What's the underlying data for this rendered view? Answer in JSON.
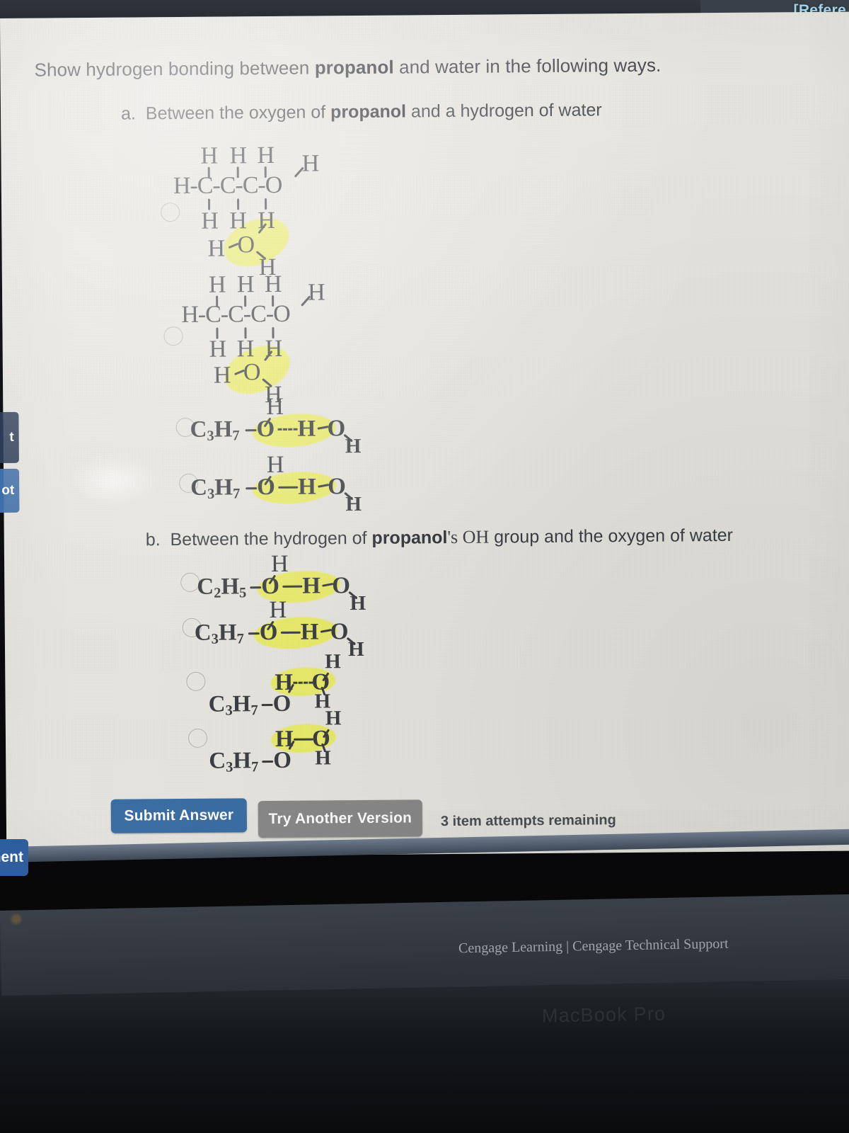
{
  "browser": {
    "tab_label": "[Refere"
  },
  "sidebar": {
    "buttons": [
      {
        "label": "t"
      },
      {
        "label": "ot"
      },
      {
        "label": "ment"
      }
    ]
  },
  "question": {
    "stem_pre": "Show hydrogen bonding between ",
    "stem_bold": "propanol",
    "stem_post": " and water in the following ways.",
    "part_a": {
      "marker": "a.",
      "text_pre": "Between the oxygen of ",
      "text_bold": "propanol",
      "text_post": " and a hydrogen of water"
    },
    "part_b": {
      "marker": "b.",
      "text_pre": "Between the hydrogen of ",
      "text_bold": "propanol",
      "text_post_serif": "'s OH",
      "text_post": " group and the oxygen of water"
    }
  },
  "answers": {
    "a": [
      {
        "id": "a1",
        "type": "expanded-structure",
        "atoms": [
          "H",
          "C",
          "C",
          "C",
          "O",
          "H",
          "H",
          "H",
          "H",
          "H",
          "H",
          "H",
          "H",
          "O",
          "H"
        ],
        "description": "H-C-C-C-O with H above each C and H below each C, terminal H on O, plus water H-O-H highlighted",
        "backbone": "H-C-C-C-O",
        "top_hydrogens": [
          "H",
          "H",
          "H"
        ],
        "terminal_h": "H",
        "bottom_hydrogens": [
          "H",
          "H",
          "H"
        ],
        "water": {
          "left_h": "H",
          "oxygen": "O",
          "lower_h": "H"
        },
        "highlighted": true
      },
      {
        "id": "a2",
        "type": "expanded-structure",
        "backbone": "H-C-C-C-O",
        "top_hydrogens": [
          "H",
          "H",
          "H"
        ],
        "terminal_h": "H",
        "bottom_hydrogens": [
          "H",
          "H",
          "H"
        ],
        "water": {
          "left_h": "H",
          "oxygen": "O",
          "lower_h": "H"
        },
        "highlighted": true
      },
      {
        "id": "a3",
        "type": "condensed",
        "group": "C3H7",
        "oxygen": "O",
        "bond_style": "dashed",
        "bridge_h": "H",
        "water_o": "O",
        "water_top_h": "H",
        "water_lower_h": "H",
        "highlighted": true
      },
      {
        "id": "a4",
        "type": "condensed",
        "group": "C3H7",
        "oxygen": "O",
        "bond_style": "solid",
        "bridge_h": "H",
        "water_o": "O",
        "water_top_h": "H",
        "water_lower_h": "H",
        "highlighted": true
      }
    ],
    "b": [
      {
        "id": "b1",
        "type": "condensed",
        "group": "C2H5",
        "oxygen": "O",
        "bond_style": "solid",
        "bridge_h": "H",
        "water_o": "O",
        "water_top_h": "H",
        "water_lower_h": "H",
        "highlighted": true
      },
      {
        "id": "b2",
        "type": "condensed",
        "group": "C3H7",
        "oxygen": "O",
        "bond_style": "solid",
        "bridge_h": "H",
        "water_o": "O",
        "water_top_h": "H",
        "water_lower_h": "H",
        "highlighted": true
      },
      {
        "id": "b3",
        "type": "two-line",
        "group": "C3H7",
        "oxygen": "O",
        "bridge_h": "H",
        "bond_style": "dashed",
        "water_o": "O",
        "water_top_h": "H",
        "water_lower_h": "H",
        "highlighted": true
      },
      {
        "id": "b4",
        "type": "two-line",
        "group": "C3H7",
        "oxygen": "O",
        "bridge_h": "H",
        "bond_style": "solid",
        "water_o": "O",
        "water_top_h": "H",
        "water_lower_h": "H",
        "highlighted": true
      }
    ]
  },
  "actions": {
    "submit_label": "Submit Answer",
    "try_another_label": "Try Another Version",
    "attempts_text": "3 item attempts remaining"
  },
  "footer": {
    "text": "Cengage Learning | Cengage Technical Support",
    "device_label": "MacBook Pro"
  },
  "colors": {
    "page_bg": "#e9e7e1",
    "submit_blue": "#3b6fa5",
    "try_gray": "#8a8a8a",
    "highlight_yellow": "#eef04a",
    "ink": "#3c3f44",
    "tab_blue": "#9fd3e8"
  }
}
